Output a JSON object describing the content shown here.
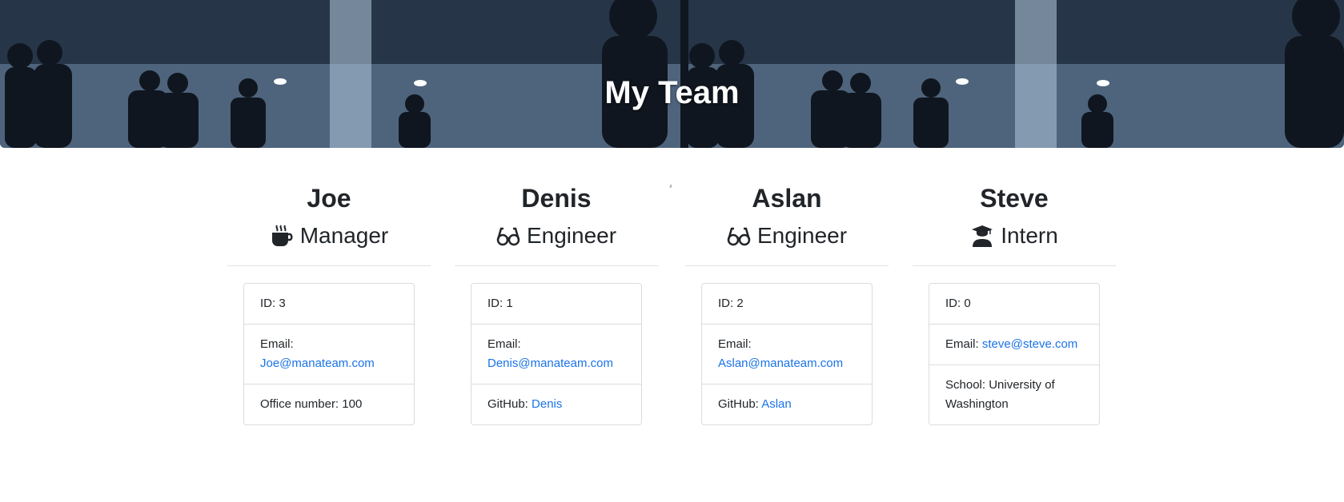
{
  "header": {
    "title": "My Team"
  },
  "members": [
    {
      "name": "Joe",
      "role": "Manager",
      "role_icon": "coffee-icon",
      "id_text": "ID: 3",
      "email_label": "Email:",
      "email": "Joe@manateam.com",
      "extra_label": "Office number: 100",
      "extra_value": ""
    },
    {
      "name": "Denis",
      "role": "Engineer",
      "role_icon": "glasses-icon",
      "id_text": "ID: 1",
      "email_label": "Email:",
      "email": "Denis@manateam.com",
      "extra_label": "GitHub:",
      "extra_value": "Denis"
    },
    {
      "name": "Aslan",
      "role": "Engineer",
      "role_icon": "glasses-icon",
      "id_text": "ID: 2",
      "email_label": "Email:",
      "email": "Aslan@manateam.com",
      "extra_label": "GitHub:",
      "extra_value": "Aslan"
    },
    {
      "name": "Steve",
      "role": "Intern",
      "role_icon": "graduate-icon",
      "id_text": "ID: 0",
      "email_label": "Email:",
      "email": "steve@steve.com",
      "extra_label": "School: University of Washington",
      "extra_value": ""
    }
  ],
  "colors": {
    "link": "#1a73e8",
    "text": "#212529",
    "border": "#dcdcdc",
    "hero_text": "#ffffff"
  }
}
